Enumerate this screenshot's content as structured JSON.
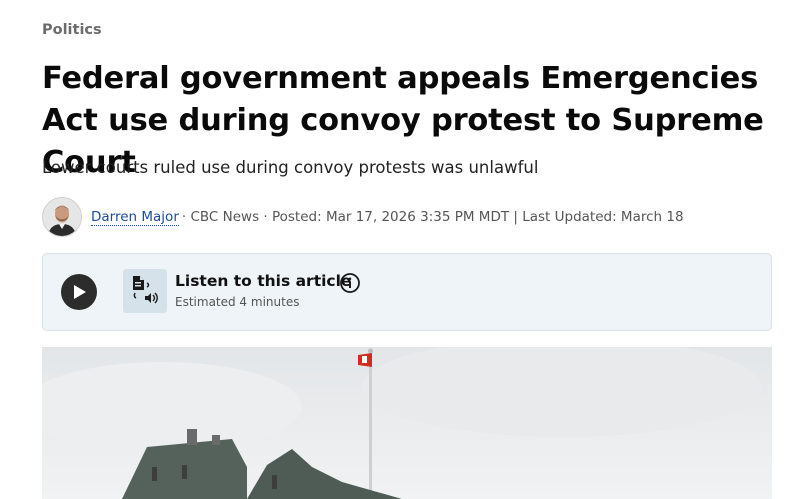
{
  "article": {
    "category": "Politics",
    "headline": "Federal government appeals Emergencies Act use during convoy protest to Supreme Court",
    "deck": "Lower courts ruled use during convoy protests was unlawful",
    "byline": {
      "author": "Darren Major",
      "meta": "· CBC News · Posted: Mar 17, 2026 3:35 PM MDT | Last Updated: March 18"
    }
  },
  "audio_player": {
    "title": "Listen to this article",
    "subtitle": "Estimated 4 minutes",
    "play_icon": "play-icon",
    "document_icon": "document-audio-icon",
    "info_icon": "info-icon"
  },
  "hero_image": {
    "subject": "Parliament building rooftop with Canadian flag on flagpole"
  },
  "colors": {
    "author_link": "#1a4d9c",
    "audio_card_bg": "#eef4f7",
    "category": "#6b6b6b"
  }
}
